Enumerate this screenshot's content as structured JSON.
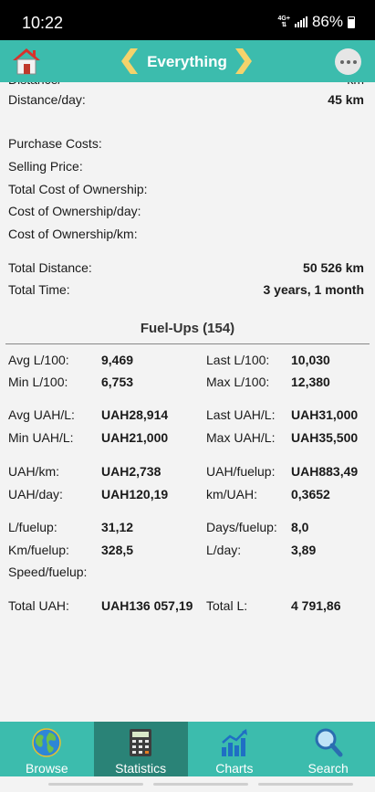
{
  "status_bar": {
    "time": "10:22",
    "network": "4G+",
    "battery": "86%"
  },
  "header": {
    "title": "Everything"
  },
  "stats": [
    {
      "label": "Distance/day:",
      "value": "45 km"
    },
    {
      "label": "Purchase Costs:",
      "value": ""
    },
    {
      "label": "Selling Price:",
      "value": ""
    },
    {
      "label": "Total Cost of Ownership:",
      "value": ""
    },
    {
      "label": "Cost of Ownership/day:",
      "value": ""
    },
    {
      "label": "Cost of Ownership/km:",
      "value": ""
    },
    {
      "label": "Total Distance:",
      "value": "50 526 km"
    },
    {
      "label": "Total Time:",
      "value": "3 years, 1 month"
    }
  ],
  "fuelups": {
    "title": "Fuel-Ups (154)",
    "rows": [
      {
        "l1": "Avg L/100:",
        "v1": "9,469",
        "l2": "Last L/100:",
        "v2": "10,030"
      },
      {
        "l1": "Min L/100:",
        "v1": "6,753",
        "l2": "Max L/100:",
        "v2": "12,380"
      },
      {
        "l1": "Avg UAH/L:",
        "v1": "UAH28,914",
        "l2": "Last UAH/L:",
        "v2": "UAH31,000"
      },
      {
        "l1": "Min UAH/L:",
        "v1": "UAH21,000",
        "l2": "Max UAH/L:",
        "v2": "UAH35,500"
      },
      {
        "l1": "UAH/km:",
        "v1": "UAH2,738",
        "l2": "UAH/fuelup:",
        "v2": "UAH883,49"
      },
      {
        "l1": "UAH/day:",
        "v1": "UAH120,19",
        "l2": "km/UAH:",
        "v2": "0,3652"
      },
      {
        "l1": "L/fuelup:",
        "v1": "31,12",
        "l2": "Days/fuelup:",
        "v2": "8,0"
      },
      {
        "l1": "Km/fuelup:",
        "v1": "328,5",
        "l2": "L/day:",
        "v2": "3,89"
      },
      {
        "l1": "Speed/fuelup:",
        "v1": "",
        "l2": "",
        "v2": ""
      },
      {
        "l1": "Total UAH:",
        "v1": "UAH136 057,19",
        "l2": "Total L:",
        "v2": "4 791,86"
      }
    ]
  },
  "bottom_nav": [
    {
      "label": "Browse",
      "icon": "globe-icon"
    },
    {
      "label": "Statistics",
      "icon": "calculator-icon"
    },
    {
      "label": "Charts",
      "icon": "bar-chart-icon"
    },
    {
      "label": "Search",
      "icon": "magnifier-icon"
    }
  ],
  "colors": {
    "accent": "#3cbcad",
    "active_tab": "#2a8377",
    "arrow": "#f5d36b"
  }
}
